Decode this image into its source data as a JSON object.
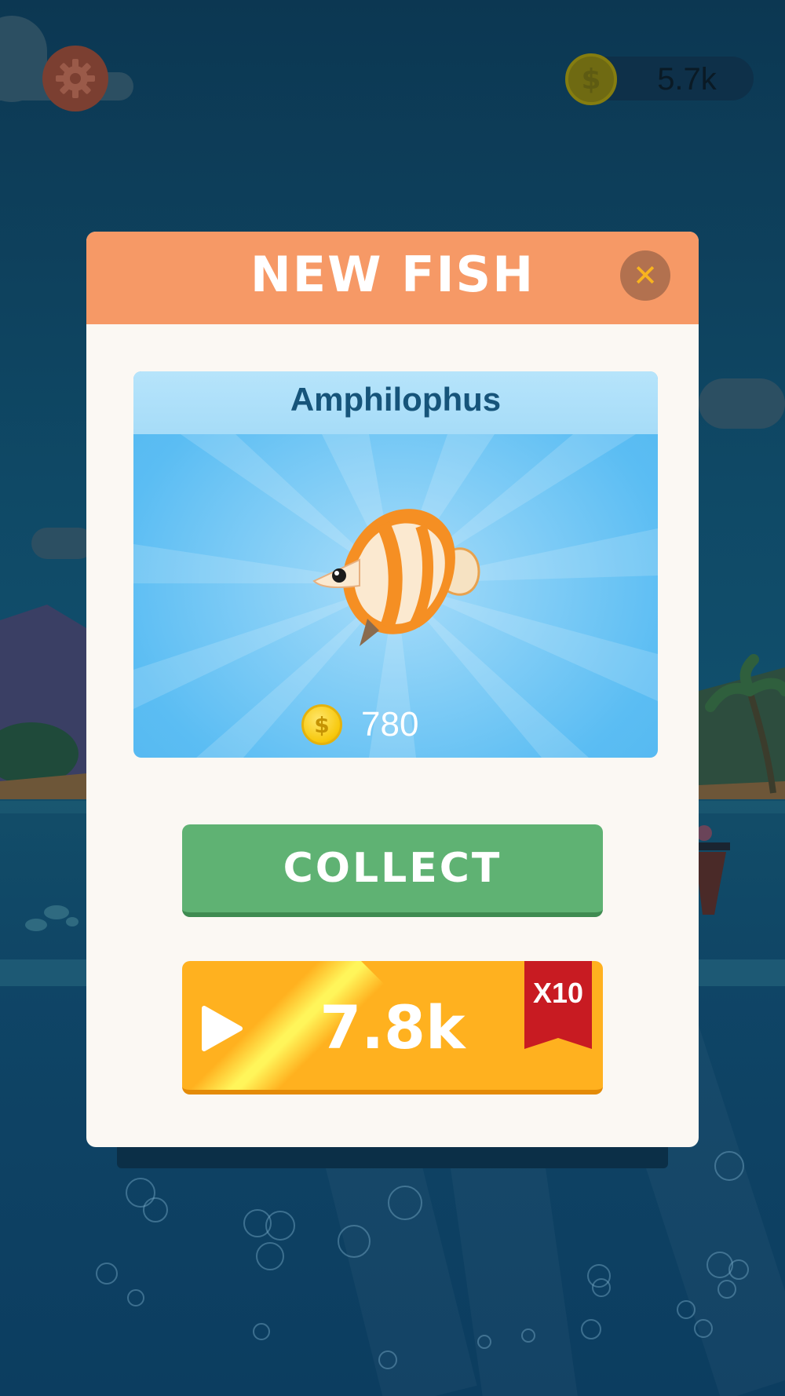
{
  "hud": {
    "settings_icon": "gear-icon",
    "coin_icon": "dollar-coin-icon",
    "coin_balance": "5.7k"
  },
  "modal": {
    "title": "NEW FISH",
    "close_icon": "close-icon",
    "close_glyph": "✕",
    "fish_name": "Amphilophus",
    "fish_value": "780",
    "value_coin_icon": "dollar-coin-icon",
    "collect_label": "COLLECT",
    "reward_label": "7.8k",
    "reward_badge": "X10",
    "reward_icon": "play-icon"
  },
  "colors": {
    "header": "#f69966",
    "close_button": "#b2714f",
    "collect_button": "#5fb273",
    "reward_button": "#ffb11f",
    "badge": "#c81b22",
    "fish_name": "#16547a"
  }
}
